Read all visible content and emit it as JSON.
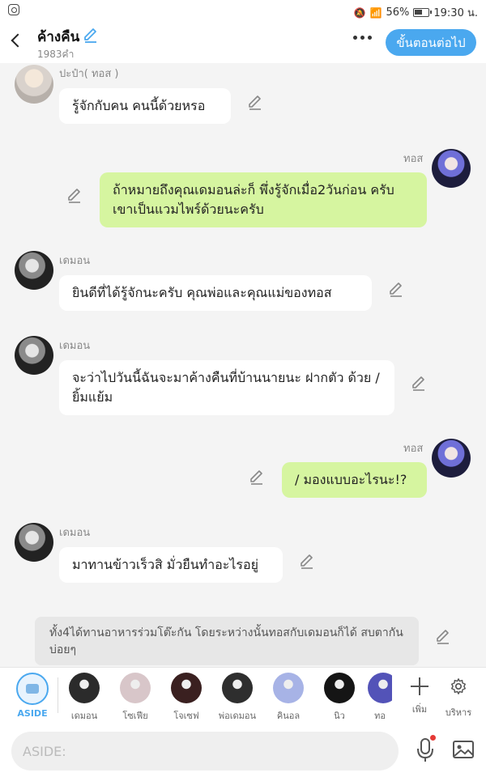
{
  "status": {
    "battery": "56%",
    "time": "19:30 น."
  },
  "header": {
    "title": "ค้างคืน",
    "subtitle": "1983คำ",
    "next_label": "ขั้นตอนต่อไป"
  },
  "messages": [
    {
      "sender": "ปะป๋า( ทอส )",
      "text": "รู้จักกับคน คนนี้ด้วยหรอ"
    },
    {
      "sender": "ทอส",
      "text": "ถ้าหมายถึงคุณเดมอนล่ะก็ พึ่งรู้จักเมื่อ2วันก่อน ครับ เขาเป็นแวมไพร์ด้วยนะครับ"
    },
    {
      "sender": "เดมอน",
      "text": "ยินดีที่ได้รู้จักนะครับ คุณพ่อและคุณแม่ของทอส"
    },
    {
      "sender": "เดมอน",
      "text": "จะว่าไปวันนี้ฉันจะมาค้างคืนที่บ้านนายนะ ฝากตัว ด้วย / ยิ้มแย้ม"
    },
    {
      "sender": "ทอส",
      "text": "/ มองแบบอะไรนะ!?"
    },
    {
      "sender": "เดมอน",
      "text": "มาทานข้าวเร็วสิ มั่วยืนทำอะไรอยู่"
    }
  ],
  "narration": "ทั้ง4ได้ทานอาหารร่วมโต๊ะกัน โดยระหว่างนั้นทอสกับเดมอนก็ได้ สบตากันบ่อยๆ",
  "characters": {
    "aside_label": "ASIDE",
    "items": [
      {
        "name": "เดมอน",
        "color": "#2b2b2b"
      },
      {
        "name": "โซเฟีย",
        "color": "#d8c6c9"
      },
      {
        "name": "โจเซฟ",
        "color": "#3a2020"
      },
      {
        "name": "พ่อเดมอน",
        "color": "#2e2e2e"
      },
      {
        "name": "คินอล",
        "color": "#a7b3e6"
      },
      {
        "name": "นิว",
        "color": "#151515"
      },
      {
        "name": "ทอ",
        "color": "#5353b8"
      }
    ],
    "add_label": "เพิ่ม",
    "manage_label": "บริหาร"
  },
  "input": {
    "placeholder": "ASIDE:"
  },
  "colors": {
    "accent": "#4aa8ef",
    "right_bubble": "#d6f5a0",
    "left_bubble": "#ffffff"
  }
}
